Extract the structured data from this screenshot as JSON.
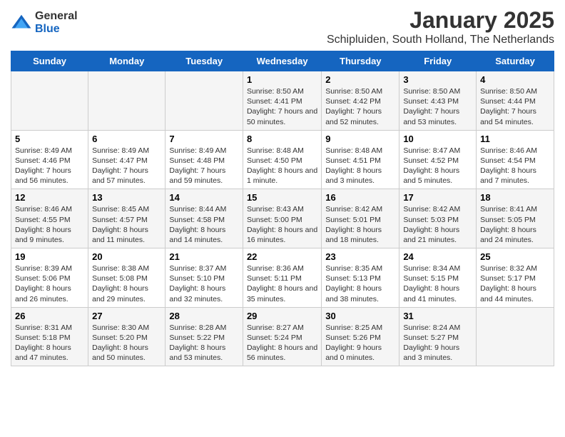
{
  "logo": {
    "general": "General",
    "blue": "Blue"
  },
  "title": "January 2025",
  "subtitle": "Schipluiden, South Holland, The Netherlands",
  "days_of_week": [
    "Sunday",
    "Monday",
    "Tuesday",
    "Wednesday",
    "Thursday",
    "Friday",
    "Saturday"
  ],
  "weeks": [
    [
      {
        "day": "",
        "info": ""
      },
      {
        "day": "",
        "info": ""
      },
      {
        "day": "",
        "info": ""
      },
      {
        "day": "1",
        "info": "Sunrise: 8:50 AM\nSunset: 4:41 PM\nDaylight: 7 hours and 50 minutes."
      },
      {
        "day": "2",
        "info": "Sunrise: 8:50 AM\nSunset: 4:42 PM\nDaylight: 7 hours and 52 minutes."
      },
      {
        "day": "3",
        "info": "Sunrise: 8:50 AM\nSunset: 4:43 PM\nDaylight: 7 hours and 53 minutes."
      },
      {
        "day": "4",
        "info": "Sunrise: 8:50 AM\nSunset: 4:44 PM\nDaylight: 7 hours and 54 minutes."
      }
    ],
    [
      {
        "day": "5",
        "info": "Sunrise: 8:49 AM\nSunset: 4:46 PM\nDaylight: 7 hours and 56 minutes."
      },
      {
        "day": "6",
        "info": "Sunrise: 8:49 AM\nSunset: 4:47 PM\nDaylight: 7 hours and 57 minutes."
      },
      {
        "day": "7",
        "info": "Sunrise: 8:49 AM\nSunset: 4:48 PM\nDaylight: 7 hours and 59 minutes."
      },
      {
        "day": "8",
        "info": "Sunrise: 8:48 AM\nSunset: 4:50 PM\nDaylight: 8 hours and 1 minute."
      },
      {
        "day": "9",
        "info": "Sunrise: 8:48 AM\nSunset: 4:51 PM\nDaylight: 8 hours and 3 minutes."
      },
      {
        "day": "10",
        "info": "Sunrise: 8:47 AM\nSunset: 4:52 PM\nDaylight: 8 hours and 5 minutes."
      },
      {
        "day": "11",
        "info": "Sunrise: 8:46 AM\nSunset: 4:54 PM\nDaylight: 8 hours and 7 minutes."
      }
    ],
    [
      {
        "day": "12",
        "info": "Sunrise: 8:46 AM\nSunset: 4:55 PM\nDaylight: 8 hours and 9 minutes."
      },
      {
        "day": "13",
        "info": "Sunrise: 8:45 AM\nSunset: 4:57 PM\nDaylight: 8 hours and 11 minutes."
      },
      {
        "day": "14",
        "info": "Sunrise: 8:44 AM\nSunset: 4:58 PM\nDaylight: 8 hours and 14 minutes."
      },
      {
        "day": "15",
        "info": "Sunrise: 8:43 AM\nSunset: 5:00 PM\nDaylight: 8 hours and 16 minutes."
      },
      {
        "day": "16",
        "info": "Sunrise: 8:42 AM\nSunset: 5:01 PM\nDaylight: 8 hours and 18 minutes."
      },
      {
        "day": "17",
        "info": "Sunrise: 8:42 AM\nSunset: 5:03 PM\nDaylight: 8 hours and 21 minutes."
      },
      {
        "day": "18",
        "info": "Sunrise: 8:41 AM\nSunset: 5:05 PM\nDaylight: 8 hours and 24 minutes."
      }
    ],
    [
      {
        "day": "19",
        "info": "Sunrise: 8:39 AM\nSunset: 5:06 PM\nDaylight: 8 hours and 26 minutes."
      },
      {
        "day": "20",
        "info": "Sunrise: 8:38 AM\nSunset: 5:08 PM\nDaylight: 8 hours and 29 minutes."
      },
      {
        "day": "21",
        "info": "Sunrise: 8:37 AM\nSunset: 5:10 PM\nDaylight: 8 hours and 32 minutes."
      },
      {
        "day": "22",
        "info": "Sunrise: 8:36 AM\nSunset: 5:11 PM\nDaylight: 8 hours and 35 minutes."
      },
      {
        "day": "23",
        "info": "Sunrise: 8:35 AM\nSunset: 5:13 PM\nDaylight: 8 hours and 38 minutes."
      },
      {
        "day": "24",
        "info": "Sunrise: 8:34 AM\nSunset: 5:15 PM\nDaylight: 8 hours and 41 minutes."
      },
      {
        "day": "25",
        "info": "Sunrise: 8:32 AM\nSunset: 5:17 PM\nDaylight: 8 hours and 44 minutes."
      }
    ],
    [
      {
        "day": "26",
        "info": "Sunrise: 8:31 AM\nSunset: 5:18 PM\nDaylight: 8 hours and 47 minutes."
      },
      {
        "day": "27",
        "info": "Sunrise: 8:30 AM\nSunset: 5:20 PM\nDaylight: 8 hours and 50 minutes."
      },
      {
        "day": "28",
        "info": "Sunrise: 8:28 AM\nSunset: 5:22 PM\nDaylight: 8 hours and 53 minutes."
      },
      {
        "day": "29",
        "info": "Sunrise: 8:27 AM\nSunset: 5:24 PM\nDaylight: 8 hours and 56 minutes."
      },
      {
        "day": "30",
        "info": "Sunrise: 8:25 AM\nSunset: 5:26 PM\nDaylight: 9 hours and 0 minutes."
      },
      {
        "day": "31",
        "info": "Sunrise: 8:24 AM\nSunset: 5:27 PM\nDaylight: 9 hours and 3 minutes."
      },
      {
        "day": "",
        "info": ""
      }
    ]
  ]
}
